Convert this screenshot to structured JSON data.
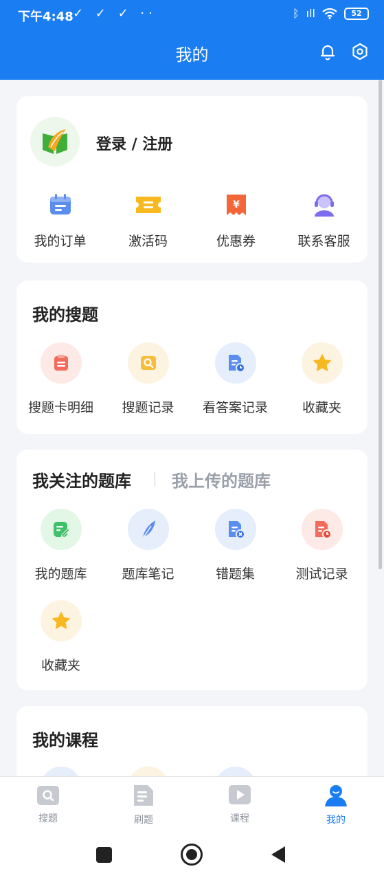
{
  "status": {
    "time": "下午4:48",
    "left_icons": "✓ ✓ ✓ ··",
    "signal_text": "ıll",
    "battery": "52"
  },
  "header": {
    "title": "我的"
  },
  "profile": {
    "login_text": "登录 / 注册",
    "items": [
      {
        "label": "我的订单",
        "icon": "calendar-icon",
        "color": "#5b8def"
      },
      {
        "label": "激活码",
        "icon": "ticket-icon",
        "color": "#f8b81f"
      },
      {
        "label": "优惠券",
        "icon": "coupon-icon",
        "color": "#f2663a"
      },
      {
        "label": "联系客服",
        "icon": "headset-icon",
        "color": "#7b6cf0"
      }
    ]
  },
  "search": {
    "title": "我的搜题",
    "items": [
      {
        "label": "搜题卡明细"
      },
      {
        "label": "搜题记录"
      },
      {
        "label": "看答案记录"
      },
      {
        "label": "收藏夹"
      }
    ]
  },
  "banks": {
    "tab_active": "我关注的题库",
    "tab_inactive": "我上传的题库",
    "items": [
      {
        "label": "我的题库"
      },
      {
        "label": "题库笔记"
      },
      {
        "label": "错题集"
      },
      {
        "label": "测试记录"
      },
      {
        "label": "收藏夹"
      }
    ]
  },
  "courses": {
    "title": "我的课程"
  },
  "tabs": [
    {
      "label": "搜题"
    },
    {
      "label": "刷题"
    },
    {
      "label": "课程"
    },
    {
      "label": "我的"
    }
  ],
  "colors": {
    "primary": "#1a7ef2",
    "bg": "#f3f5f8"
  }
}
